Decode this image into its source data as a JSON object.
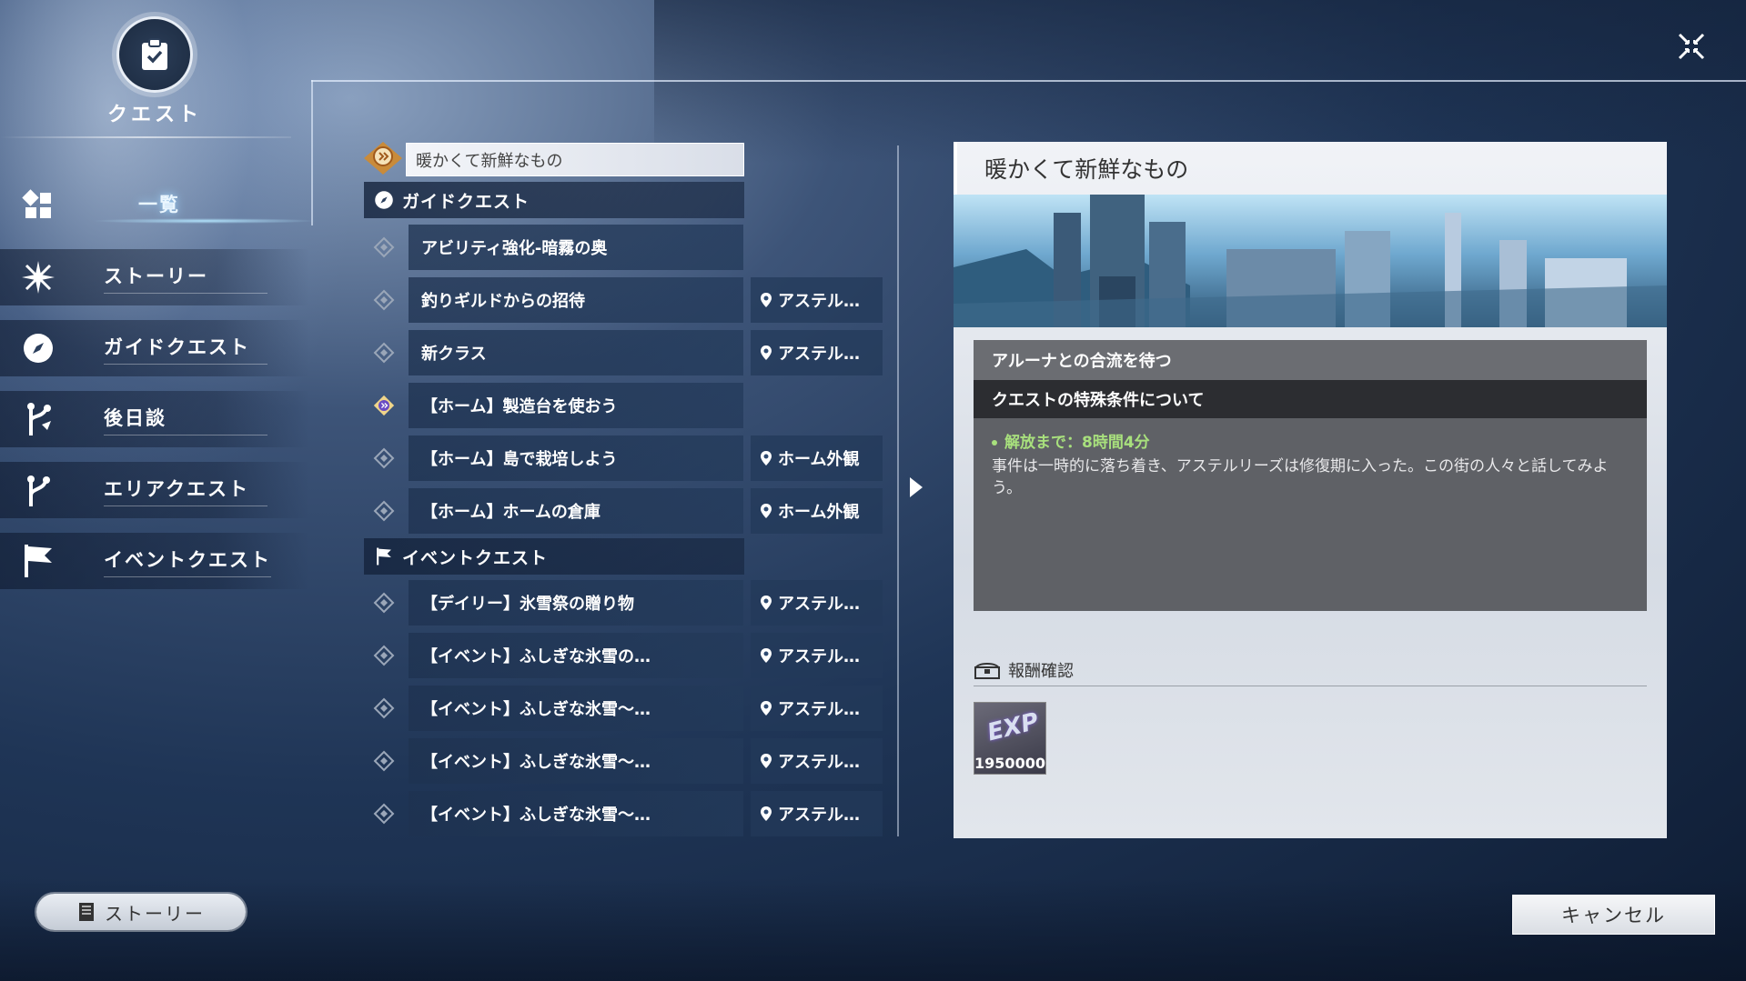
{
  "header": {
    "title": "クエスト",
    "emblem_icon": "quest-clipboard-icon"
  },
  "sidebar": {
    "items": [
      {
        "label": "一覧",
        "icon": "grid-icon",
        "active": true
      },
      {
        "label": "ストーリー",
        "icon": "star-burst-icon",
        "active": false
      },
      {
        "label": "ガイドクエスト",
        "icon": "compass-icon",
        "active": false
      },
      {
        "label": "後日談",
        "icon": "branch-icon",
        "active": false
      },
      {
        "label": "エリアクエスト",
        "icon": "path-icon",
        "active": false
      },
      {
        "label": "イベントクエスト",
        "icon": "flag-icon",
        "active": false
      }
    ]
  },
  "quest_list": {
    "selected": "暖かくて新鮮なもの",
    "sections": [
      {
        "title": "ガイドクエスト",
        "rows": [
          {
            "name": "アビリティ強化-暗霧の奥",
            "location": ""
          },
          {
            "name": "釣りギルドからの招待",
            "location": "アステル…"
          },
          {
            "name": "新クラス",
            "location": "アステル…"
          },
          {
            "name": "【ホーム】製造台を使おう",
            "location": ""
          },
          {
            "name": "【ホーム】島で栽培しよう",
            "location": "ホーム外観"
          },
          {
            "name": "【ホーム】ホームの倉庫",
            "location": "ホーム外観"
          }
        ]
      },
      {
        "title": "イベントクエスト",
        "rows": [
          {
            "name": "【デイリー】氷雪祭の贈り物",
            "location": "アステル…"
          },
          {
            "name": "【イベント】ふしぎな氷雪の…",
            "location": "アステル…"
          },
          {
            "name": "【イベント】ふしぎな氷雪～…",
            "location": "アステル…"
          },
          {
            "name": "【イベント】ふしぎな氷雪～…",
            "location": "アステル…"
          },
          {
            "name": "【イベント】ふしぎな氷雪～…",
            "location": "アステル…"
          }
        ]
      }
    ]
  },
  "detail": {
    "title": "暖かくて新鮮なもの",
    "subtitle": "アルーナとの合流を待つ",
    "condition_header": "クエストの特殊条件について",
    "unlock_text": "解放まで：8時間4分",
    "description": "事件は一時的に落ち着き、アステルリーズは修復期に入った。この街の人々と話してみよう。",
    "reward_label": "報酬確認",
    "reward": {
      "type": "EXP",
      "quantity": "1950000"
    }
  },
  "footer": {
    "story_button": "ストーリー",
    "cancel_button": "キャンセル"
  },
  "colors": {
    "accent_green": "#a8e07d",
    "panel_dark": "#5f6166",
    "bar_dark": "#2c2d31"
  }
}
